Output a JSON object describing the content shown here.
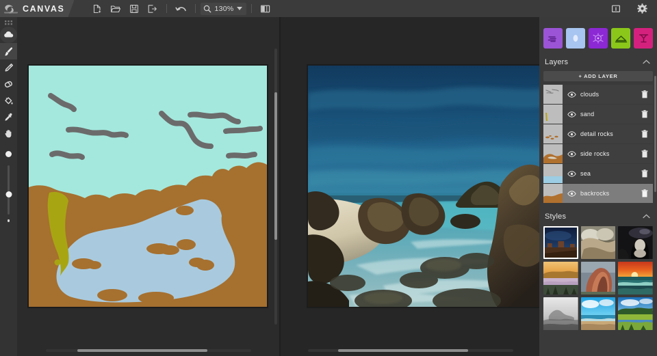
{
  "app": {
    "brand_name": "CANVAS",
    "logo_icon": "nvidia-logo-icon",
    "background": "#2e2e2e"
  },
  "toolbar": {
    "file_actions": [
      {
        "name": "new-file-button",
        "icon": "new-file-icon",
        "title": "New"
      },
      {
        "name": "open-file-button",
        "icon": "folder-open-icon",
        "title": "Open"
      },
      {
        "name": "save-button",
        "icon": "save-disk-icon",
        "title": "Save"
      },
      {
        "name": "export-button",
        "icon": "export-icon",
        "title": "Export"
      }
    ],
    "undo": {
      "name": "undo-button",
      "icon": "undo-arrow-icon",
      "title": "Undo"
    },
    "zoom": {
      "icon": "magnifier-icon",
      "value": "130%",
      "caret": "chevron-down-icon"
    },
    "layout_toggle": {
      "name": "split-view-button",
      "icon": "split-view-icon"
    },
    "info_button": {
      "name": "info-button",
      "icon": "info-panel-icon"
    },
    "settings_button": {
      "name": "settings-button",
      "icon": "gear-icon"
    }
  },
  "left_toolbar": {
    "grip_icon": "drag-grip-icon",
    "tools": [
      {
        "name": "tool-material",
        "icon": "cloud-material-icon",
        "active": false,
        "round": true
      },
      {
        "name": "tool-brush",
        "icon": "paintbrush-icon",
        "active": true,
        "round": false
      },
      {
        "name": "tool-pencil",
        "icon": "pencil-icon",
        "active": false,
        "round": false
      },
      {
        "name": "tool-eraser",
        "icon": "eraser-icon",
        "active": false,
        "round": false
      },
      {
        "name": "tool-fill",
        "icon": "paint-bucket-icon",
        "active": false,
        "round": false
      },
      {
        "name": "tool-eyedropper",
        "icon": "eyedropper-icon",
        "active": false,
        "round": false
      },
      {
        "name": "tool-pan",
        "icon": "hand-pan-icon",
        "active": false,
        "round": false
      }
    ],
    "brush_size": {
      "preview_label": "brush-size-preview",
      "slider_label": "brush-size-slider",
      "value_fraction": 0.52
    }
  },
  "materials": {
    "swatches": [
      {
        "name": "material-clouds",
        "icon": "clouds-icon",
        "color": "#9b54d6",
        "selected": false
      },
      {
        "name": "material-sky",
        "icon": "sky-icon",
        "color": "#a8c4f0",
        "selected": false
      },
      {
        "name": "material-sea",
        "icon": "water-icon",
        "color": "#8c28d4",
        "selected": false
      },
      {
        "name": "material-mountain",
        "icon": "mountain-icon",
        "color": "#8bc71a",
        "selected": false
      },
      {
        "name": "material-tree",
        "icon": "tree-icon",
        "color": "#d4217e",
        "selected": false
      }
    ]
  },
  "layers_panel": {
    "title": "Layers",
    "collapse_icon": "chevron-up-icon",
    "add_layer_label": "+ ADD LAYER",
    "eye_icon": "eye-visible-icon",
    "trash_icon": "trash-delete-icon",
    "layers": [
      {
        "name": "clouds",
        "visible": true,
        "selected": false,
        "thumb": "clouds"
      },
      {
        "name": "sand",
        "visible": true,
        "selected": false,
        "thumb": "sand"
      },
      {
        "name": "detail rocks",
        "visible": true,
        "selected": false,
        "thumb": "detail-rocks"
      },
      {
        "name": "side rocks",
        "visible": true,
        "selected": false,
        "thumb": "side-rocks"
      },
      {
        "name": "sea",
        "visible": true,
        "selected": false,
        "thumb": "sea"
      },
      {
        "name": "backrocks",
        "visible": true,
        "selected": true,
        "thumb": "backrocks"
      }
    ]
  },
  "styles_panel": {
    "title": "Styles",
    "collapse_icon": "chevron-up-icon",
    "thumbnails": [
      {
        "name": "style-desert-night",
        "selected": true
      },
      {
        "name": "style-rock-cliff",
        "selected": false
      },
      {
        "name": "style-dark-cave",
        "selected": false
      },
      {
        "name": "style-golden-lake",
        "selected": false
      },
      {
        "name": "style-red-mountain",
        "selected": false
      },
      {
        "name": "style-ocean-sunset",
        "selected": false
      },
      {
        "name": "style-misty-bw",
        "selected": false
      },
      {
        "name": "style-tropical-beach",
        "selected": false
      },
      {
        "name": "style-green-valley",
        "selected": false
      }
    ]
  },
  "canvas": {
    "segmentation_title": "segmentation-canvas",
    "render_title": "rendered-canvas",
    "palette": {
      "sky": "#a4e8dd",
      "cloud_stroke": "#6b6b6b",
      "rock": "#a6702f",
      "water": "#a9cade",
      "grass": "#a8a513"
    }
  }
}
